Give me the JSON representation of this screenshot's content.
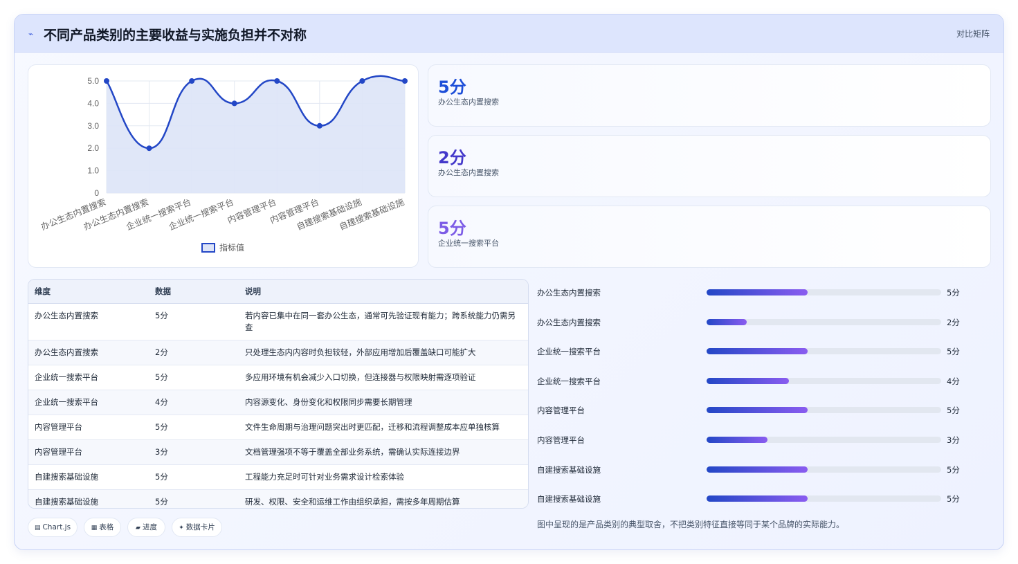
{
  "header": {
    "icon": "trend-icon",
    "title": "不同产品类别的主要收益与实施负担并不对称",
    "right_label": "对比矩阵"
  },
  "chart_data": {
    "type": "line",
    "categories": [
      "办公生态内置搜索",
      "办公生态内置搜索",
      "企业统一搜索平台",
      "企业统一搜索平台",
      "内容管理平台",
      "内容管理平台",
      "自建搜索基础设施",
      "自建搜索基础设施"
    ],
    "series": [
      {
        "name": "指标值",
        "values": [
          5,
          2,
          5,
          4,
          5,
          3,
          5,
          5
        ]
      }
    ],
    "y_ticks": [
      "0",
      "1.0",
      "2.0",
      "3.0",
      "4.0",
      "5.0"
    ],
    "ylim": [
      0,
      5
    ],
    "legend": "bottom",
    "grid": true,
    "fill": true,
    "colors": {
      "line": "#2347c6",
      "fill": "#dde4f7",
      "grid": "#e3e8f2"
    }
  },
  "stats": [
    {
      "value": "5分",
      "label": "办公生态内置搜索",
      "color": "#1d4ed8"
    },
    {
      "value": "2分",
      "label": "办公生态内置搜索",
      "color": "#4338ca"
    },
    {
      "value": "5分",
      "label": "企业统一搜索平台",
      "color": "#7c5ce6"
    }
  ],
  "table": {
    "headers": [
      "维度",
      "数据",
      "说明"
    ],
    "rows": [
      {
        "dim": "办公生态内置搜索",
        "value": "5分",
        "desc": "若内容已集中在同一套办公生态，通常可先验证现有能力；跨系统能力仍需另查"
      },
      {
        "dim": "办公生态内置搜索",
        "value": "2分",
        "desc": "只处理生态内内容时负担较轻，外部应用增加后覆盖缺口可能扩大"
      },
      {
        "dim": "企业统一搜索平台",
        "value": "5分",
        "desc": "多应用环境有机会减少入口切换，但连接器与权限映射需逐项验证"
      },
      {
        "dim": "企业统一搜索平台",
        "value": "4分",
        "desc": "内容源变化、身份变化和权限同步需要长期管理"
      },
      {
        "dim": "内容管理平台",
        "value": "5分",
        "desc": "文件生命周期与治理问题突出时更匹配，迁移和流程调整成本应单独核算"
      },
      {
        "dim": "内容管理平台",
        "value": "3分",
        "desc": "文档管理强项不等于覆盖全部业务系统，需确认实际连接边界"
      },
      {
        "dim": "自建搜索基础设施",
        "value": "5分",
        "desc": "工程能力充足时可针对业务需求设计检索体验"
      },
      {
        "dim": "自建搜索基础设施",
        "value": "5分",
        "desc": "研发、权限、安全和运维工作由组织承担，需按多年周期估算"
      }
    ]
  },
  "progress": [
    {
      "label": "办公生态内置搜索",
      "value": "5分",
      "fraction": 0.43
    },
    {
      "label": "办公生态内置搜索",
      "value": "2分",
      "fraction": 0.17
    },
    {
      "label": "企业统一搜索平台",
      "value": "5分",
      "fraction": 0.43
    },
    {
      "label": "企业统一搜索平台",
      "value": "4分",
      "fraction": 0.35
    },
    {
      "label": "内容管理平台",
      "value": "5分",
      "fraction": 0.43
    },
    {
      "label": "内容管理平台",
      "value": "3分",
      "fraction": 0.26
    },
    {
      "label": "自建搜索基础设施",
      "value": "5分",
      "fraction": 0.43
    },
    {
      "label": "自建搜索基础设施",
      "value": "5分",
      "fraction": 0.43
    }
  ],
  "footnote": "图中呈现的是产品类别的典型取舍，不把类别特征直接等同于某个品牌的实际能力。",
  "chips": [
    {
      "icon": "chart-icon",
      "glyph": "▤",
      "label": "Chart.js"
    },
    {
      "icon": "table-icon",
      "glyph": "▦",
      "label": "表格"
    },
    {
      "icon": "progress-icon",
      "glyph": "▰",
      "label": "进度"
    },
    {
      "icon": "card-icon",
      "glyph": "✦",
      "label": "数据卡片"
    }
  ]
}
